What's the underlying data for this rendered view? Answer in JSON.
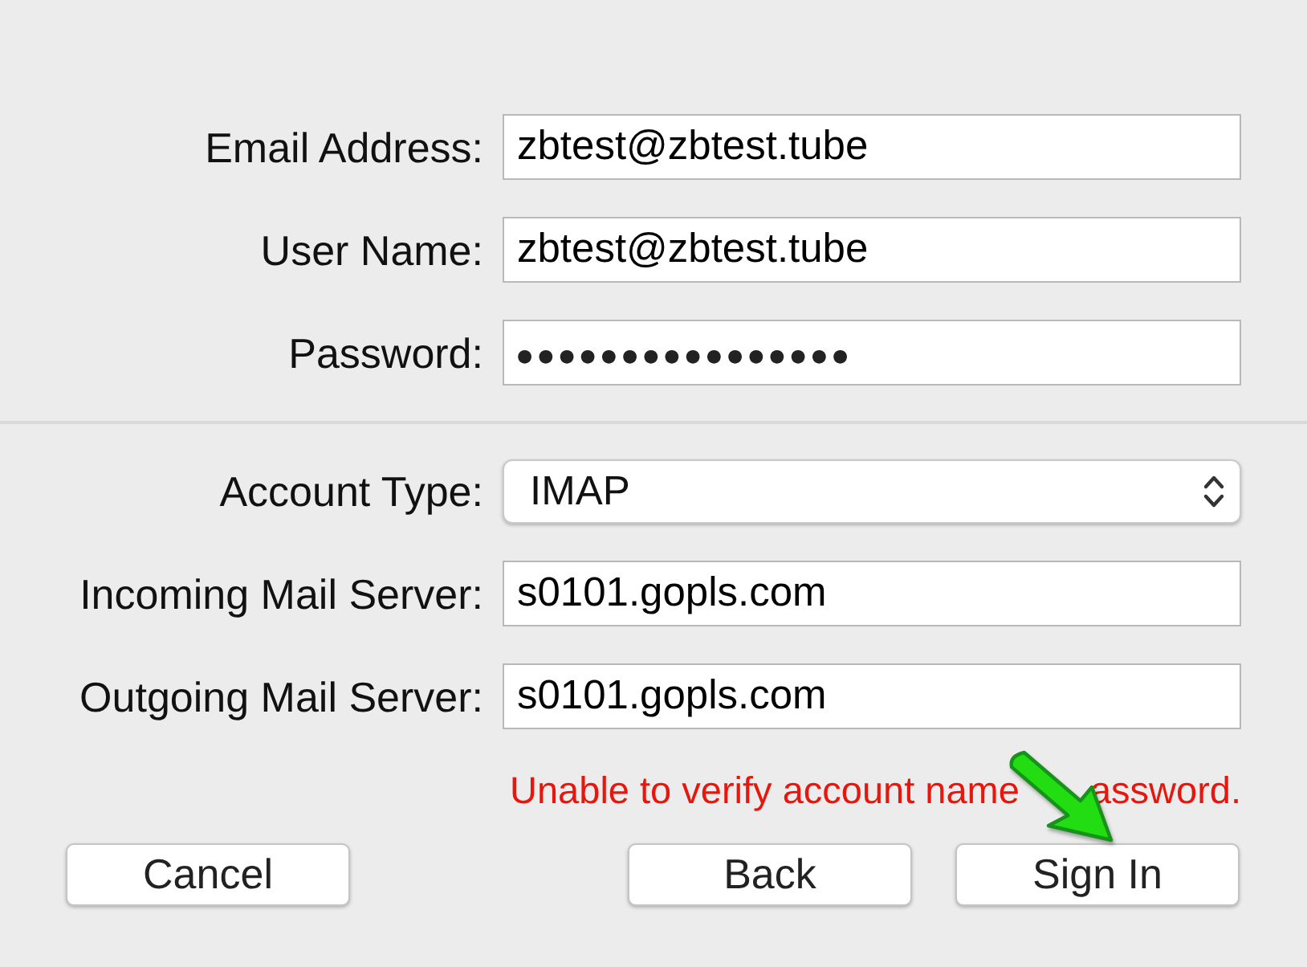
{
  "account_fields": [
    {
      "kind": "text",
      "label": "Email Address:",
      "value": "zbtest@zbtest.tube"
    },
    {
      "kind": "text",
      "label": "User Name:",
      "value": "zbtest@zbtest.tube"
    },
    {
      "kind": "password",
      "label": "Password:",
      "value": "●●●●●●●●●●●●●●●●"
    }
  ],
  "server_fields": [
    {
      "kind": "popup",
      "label": "Account Type:",
      "value": "IMAP"
    },
    {
      "kind": "text",
      "label": "Incoming Mail Server:",
      "value": "s0101.gopls.com"
    },
    {
      "kind": "text",
      "label": "Outgoing Mail Server:",
      "value": "s0101.gopls.com"
    }
  ],
  "error_message_visible_parts": [
    "Unable to verify account name",
    "assword."
  ],
  "buttons_left": [
    {
      "label": "Cancel"
    }
  ],
  "buttons_right": [
    {
      "label": "Back"
    },
    {
      "label": "Sign In"
    }
  ]
}
